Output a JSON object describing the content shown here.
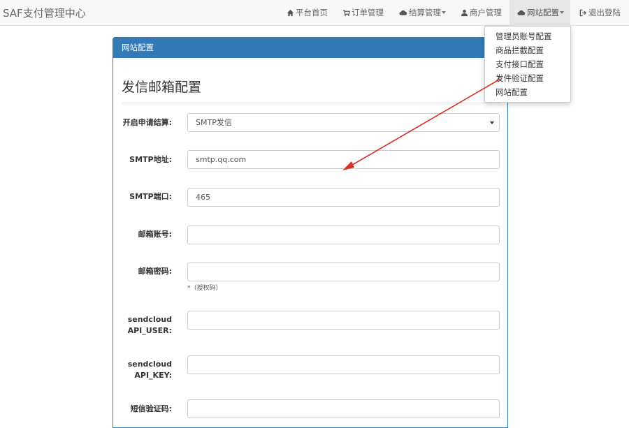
{
  "navbar": {
    "brand": "SAF支付管理中心",
    "items": [
      {
        "label": "平台首页",
        "icon": "home-icon"
      },
      {
        "label": "订单管理",
        "icon": "cart-icon"
      },
      {
        "label": "结算管理",
        "icon": "cloud-icon"
      },
      {
        "label": "商户管理",
        "icon": "user-icon"
      },
      {
        "label": "网站配置",
        "icon": "cloud-icon"
      },
      {
        "label": "退出登陆",
        "icon": "logout-icon"
      }
    ]
  },
  "dropdown": {
    "items": [
      "管理员账号配置",
      "商品拦截配置",
      "支付接口配置",
      "发件验证配置",
      "网站配置"
    ]
  },
  "panel": {
    "heading": "网站配置",
    "title": "发信邮箱配置"
  },
  "form": {
    "send_mode": {
      "label": "开启申请结算:",
      "value": "SMTP发信"
    },
    "smtp_host": {
      "label": "SMTP地址:",
      "value": "smtp.qq.com"
    },
    "smtp_port": {
      "label": "SMTP端口:",
      "value": "465"
    },
    "mail_account": {
      "label": "邮箱账号:",
      "value": ""
    },
    "mail_password": {
      "label": "邮箱密码:",
      "value": "",
      "help": "*（授权码）"
    },
    "sendcloud_user": {
      "label_line1": "sendcloud",
      "label_line2": "API_USER:",
      "value": ""
    },
    "sendcloud_key": {
      "label_line1": "sendcloud",
      "label_line2": "API_KEY:",
      "value": ""
    },
    "sms_code": {
      "label": "短信验证码:",
      "value": ""
    }
  },
  "annotation": {
    "color": "#d93025"
  }
}
